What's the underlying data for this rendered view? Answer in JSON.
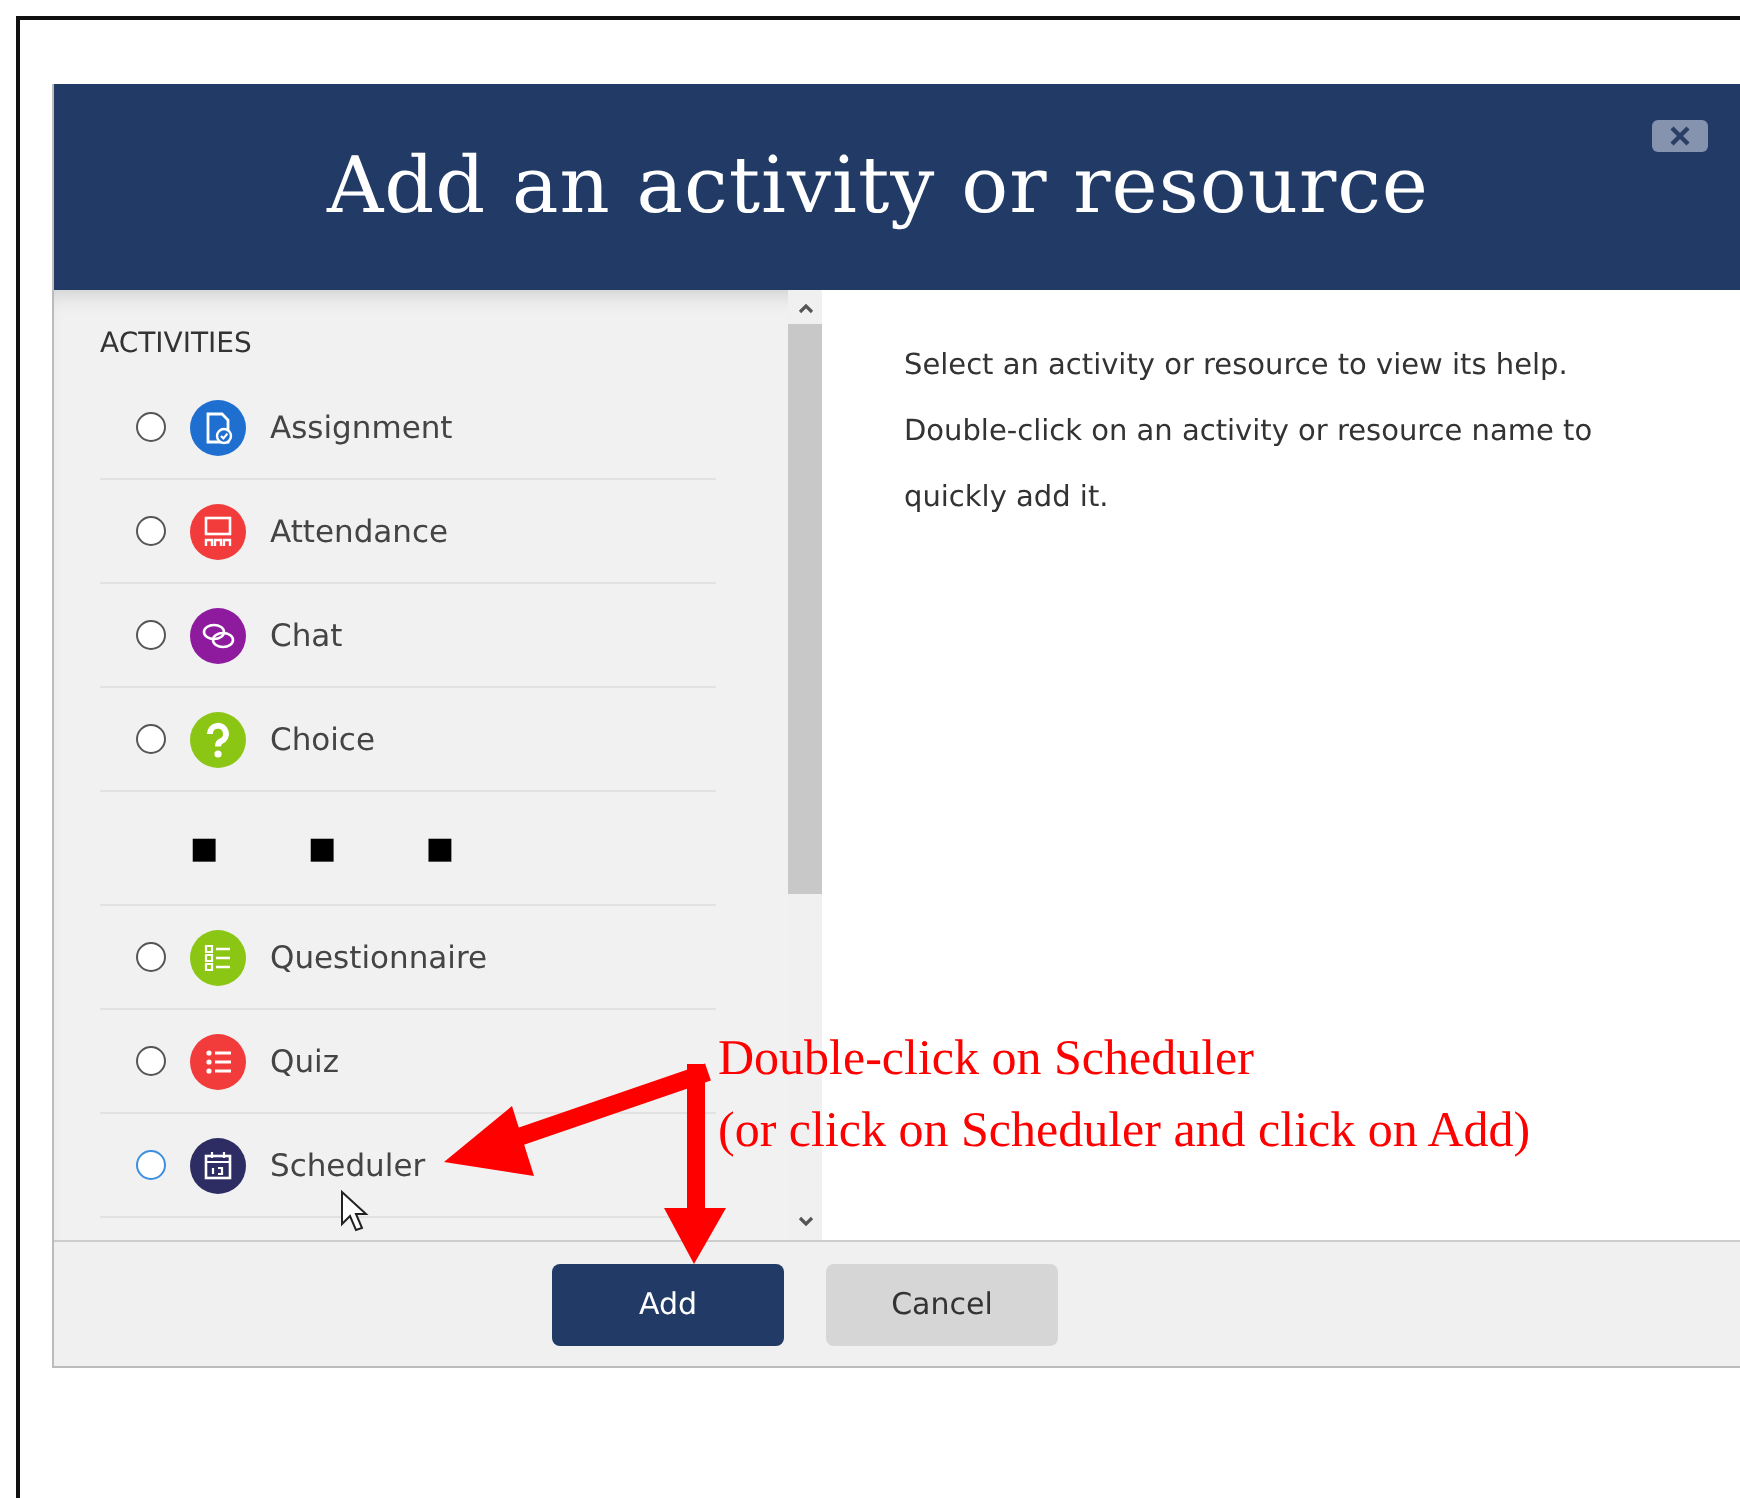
{
  "dialog": {
    "title": "Add an activity or resource"
  },
  "list": {
    "heading": "ACTIVITIES",
    "items": [
      {
        "kind": "activity",
        "label": "Assignment",
        "color": "#1f6fd1",
        "selected": false,
        "focused": false
      },
      {
        "kind": "activity",
        "label": "Attendance",
        "color": "#f23b3b",
        "selected": false,
        "focused": false
      },
      {
        "kind": "activity",
        "label": "Chat",
        "color": "#8e1b9e",
        "selected": false,
        "focused": false
      },
      {
        "kind": "activity",
        "label": "Choice",
        "color": "#8cc614",
        "selected": false,
        "focused": false
      },
      {
        "kind": "gap",
        "label": "■ ■ ■"
      },
      {
        "kind": "activity",
        "label": "Questionnaire",
        "color": "#8cc614",
        "selected": false,
        "focused": false
      },
      {
        "kind": "activity",
        "label": "Quiz",
        "color": "#f23b3b",
        "selected": false,
        "focused": false
      },
      {
        "kind": "activity",
        "label": "Scheduler",
        "color": "#2d2d63",
        "selected": false,
        "focused": true
      }
    ]
  },
  "help": [
    "Select an activity or resource to view its help.",
    "Double-click on an activity or resource name to quickly add it."
  ],
  "buttons": [
    {
      "kind": "primary",
      "label": "Add"
    },
    {
      "kind": "secondary",
      "label": "Cancel"
    }
  ],
  "annotation": {
    "lines": [
      "Double-click on Scheduler",
      "(or click on Scheduler and click on Add)"
    ]
  }
}
